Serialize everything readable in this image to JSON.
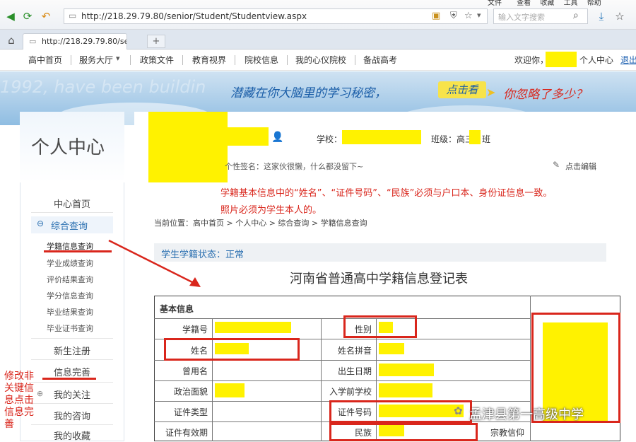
{
  "browser": {
    "menu": [
      "文件",
      "查看",
      "收藏",
      "工具",
      "帮助"
    ],
    "url": "http://218.29.79.80/senior/Student/Studentview.aspx",
    "search_placeholder": "输入文字搜索",
    "tab_title": "http://218.29.79.80/sen",
    "new_tab": "+"
  },
  "nav": {
    "items": [
      "高中首页",
      "服务大厅",
      "政策文件",
      "教育视界",
      "院校信息",
      "我的心仪院校",
      "备战高考"
    ],
    "welcome": "欢迎你，",
    "personal_center": "个人中心",
    "logout": "退出"
  },
  "banner": {
    "ghost_text": "1992, have been buildin",
    "slogan": "潜藏在你大脑里的学习秘密，",
    "click_label": "点击看",
    "question": "你忽略了多少？"
  },
  "sidebar": {
    "title": "个人中心",
    "home": "中心首页",
    "group": "综合查询",
    "subitems": [
      "学籍信息查询",
      "学业成绩查询",
      "评价结果查询",
      "学分信息查询",
      "毕业结果查询",
      "毕业证书查询"
    ],
    "items": [
      "新生注册",
      "信息完善",
      "我的关注",
      "我的咨询",
      "我的收藏"
    ]
  },
  "profile": {
    "school_label": "学校：",
    "class_label": "班级：高三",
    "class_suffix": "班",
    "signature": "个性签名：这家伙很懒，什么都没留下~",
    "edit_label": "点击编辑"
  },
  "annotations": {
    "notice_line1": "学籍基本信息中的“姓名”、“证件号码”、“民族”必须与户口本、身份证信息一致。",
    "notice_line2": "照片必须为学生本人的。",
    "left_note": [
      "修改非",
      "关键信",
      "息点击",
      "信息完",
      "善"
    ],
    "watermark": "孟津县第一高级中学"
  },
  "breadcrumb": "当前位置：高中首页 > 个人中心 > 综合查询 > 学籍信息查询",
  "status": "学生学籍状态：正常",
  "form": {
    "title": "河南省普通高中学籍信息登记表",
    "section": "基本信息",
    "left_labels": [
      "学籍号",
      "姓名",
      "曾用名",
      "政治面貌",
      "证件类型",
      "证件有效期"
    ],
    "right_labels": [
      "性别",
      "姓名拼音",
      "出生日期",
      "入学前学校",
      "证件号码",
      "民族"
    ],
    "extra_label": "宗教信仰"
  },
  "colors": {
    "accent": "#2a6fb0",
    "highlight": "#fff200",
    "annotation_red": "#d9261c"
  }
}
